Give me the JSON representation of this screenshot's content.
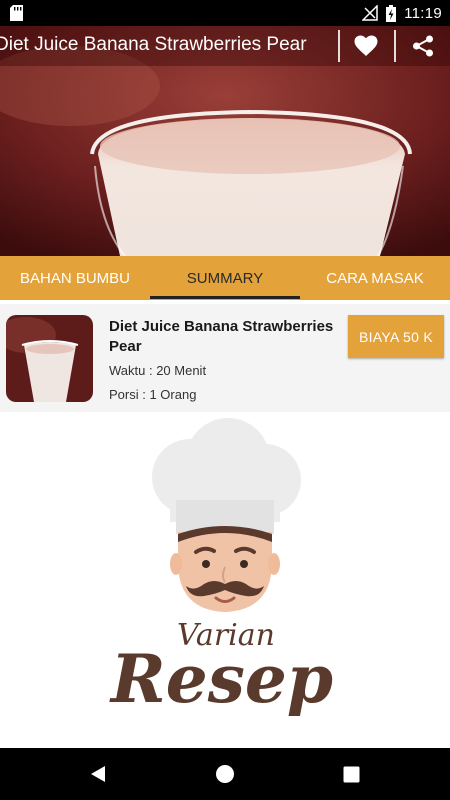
{
  "status_bar": {
    "time": "11:19",
    "icons": [
      "sd-card-icon",
      "signal-off-icon",
      "battery-charging-icon"
    ]
  },
  "app_bar": {
    "title": "Diet Juice Banana Strawberries Pear",
    "icons": [
      "heart-icon",
      "share-icon"
    ]
  },
  "tabs": [
    {
      "label": "BAHAN BUMBU",
      "active": false
    },
    {
      "label": "SUMMARY",
      "active": true
    },
    {
      "label": "CARA MASAK",
      "active": false
    }
  ],
  "summary": {
    "title": "Diet Juice Banana Strawberries Pear",
    "time": "Waktu : 20 Menit",
    "servings": "Porsi : 1 Orang",
    "cost_label": "BIAYA 50 K"
  },
  "logo": {
    "line1": "Varian",
    "line2": "Resep"
  },
  "nav_bar": {
    "icons": [
      "back-icon",
      "home-icon",
      "recents-icon"
    ]
  },
  "colors": {
    "accent": "#e4a23b",
    "logo_brown": "#5a3a2c"
  }
}
